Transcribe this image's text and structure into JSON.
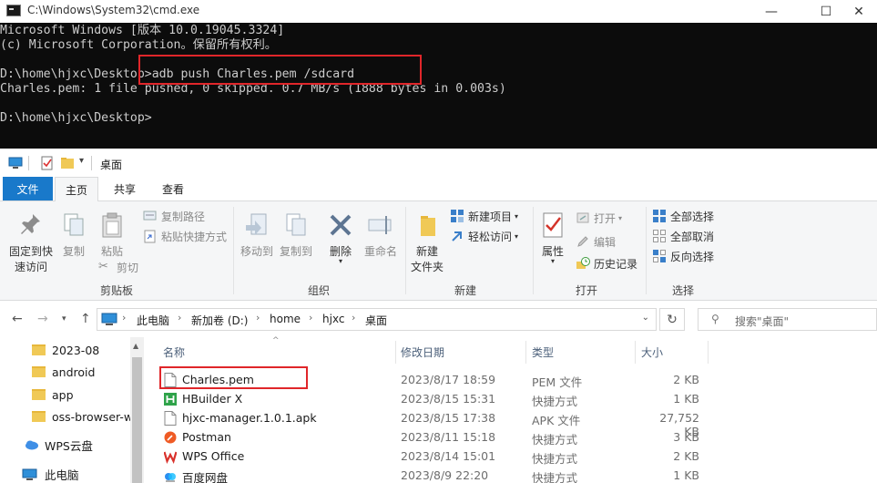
{
  "cmd": {
    "title": "C:\\Windows\\System32\\cmd.exe",
    "lines": [
      "Microsoft Windows [版本 10.0.19045.3324]",
      "(c) Microsoft Corporation。保留所有权利。",
      "",
      "D:\\home\\hjxc\\Desktop>adb push Charles.pem /sdcard",
      "Charles.pem: 1 file pushed, 0 skipped. 0.7 MB/s (1888 bytes in 0.003s)",
      "",
      "D:\\home\\hjxc\\Desktop>"
    ],
    "highlight_color": "#e0262a"
  },
  "window_controls": {
    "minimize": "—",
    "maximize": "☐",
    "close": "✕"
  },
  "explorer": {
    "title": "桌面",
    "tabs": {
      "file": "文件",
      "home": "主页",
      "share": "共享",
      "view": "查看"
    },
    "ribbon": {
      "clipboard": {
        "label": "剪贴板",
        "pin_line1": "固定到快",
        "pin_line2": "速访问",
        "copy": "复制",
        "paste": "粘贴",
        "copy_path": "复制路径",
        "paste_shortcut": "粘贴快捷方式",
        "cut": "剪切"
      },
      "organize": {
        "label": "组织",
        "move_to": "移动到",
        "copy_to": "复制到",
        "delete": "删除",
        "rename": "重命名"
      },
      "new": {
        "label": "新建",
        "new_folder_line1": "新建",
        "new_folder_line2": "文件夹",
        "new_item": "新建项目",
        "easy_access": "轻松访问"
      },
      "open": {
        "label": "打开",
        "properties": "属性",
        "open": "打开",
        "edit": "编辑",
        "history": "历史记录"
      },
      "select": {
        "label": "选择",
        "select_all": "全部选择",
        "select_none": "全部取消",
        "invert": "反向选择"
      }
    },
    "address": {
      "crumbs": [
        "此电脑",
        "新加卷 (D:)",
        "home",
        "hjxc",
        "桌面"
      ],
      "search_placeholder": "搜索\"桌面\""
    },
    "nav_items": [
      "2023-08",
      "android",
      "app",
      "oss-browser-w",
      "WPS云盘",
      "此电脑"
    ],
    "columns": {
      "name": "名称",
      "date": "修改日期",
      "type": "类型",
      "size": "大小"
    },
    "files": [
      {
        "name": "Charles.pem",
        "date": "2023/8/17 18:59",
        "type": "PEM 文件",
        "size": "2 KB",
        "icon": "blank-file-icon"
      },
      {
        "name": "HBuilder X",
        "date": "2023/8/15 15:31",
        "type": "快捷方式",
        "size": "1 KB",
        "icon": "hbuilder-icon"
      },
      {
        "name": "hjxc-manager.1.0.1.apk",
        "date": "2023/8/15 17:38",
        "type": "APK 文件",
        "size": "27,752 KB",
        "icon": "blank-file-icon"
      },
      {
        "name": "Postman",
        "date": "2023/8/11 15:18",
        "type": "快捷方式",
        "size": "3 KB",
        "icon": "postman-icon"
      },
      {
        "name": "WPS Office",
        "date": "2023/8/14 15:01",
        "type": "快捷方式",
        "size": "2 KB",
        "icon": "wps-icon"
      },
      {
        "name": "百度网盘",
        "date": "2023/8/9 22:20",
        "type": "快捷方式",
        "size": "1 KB",
        "icon": "baidu-netdisk-icon"
      }
    ]
  }
}
